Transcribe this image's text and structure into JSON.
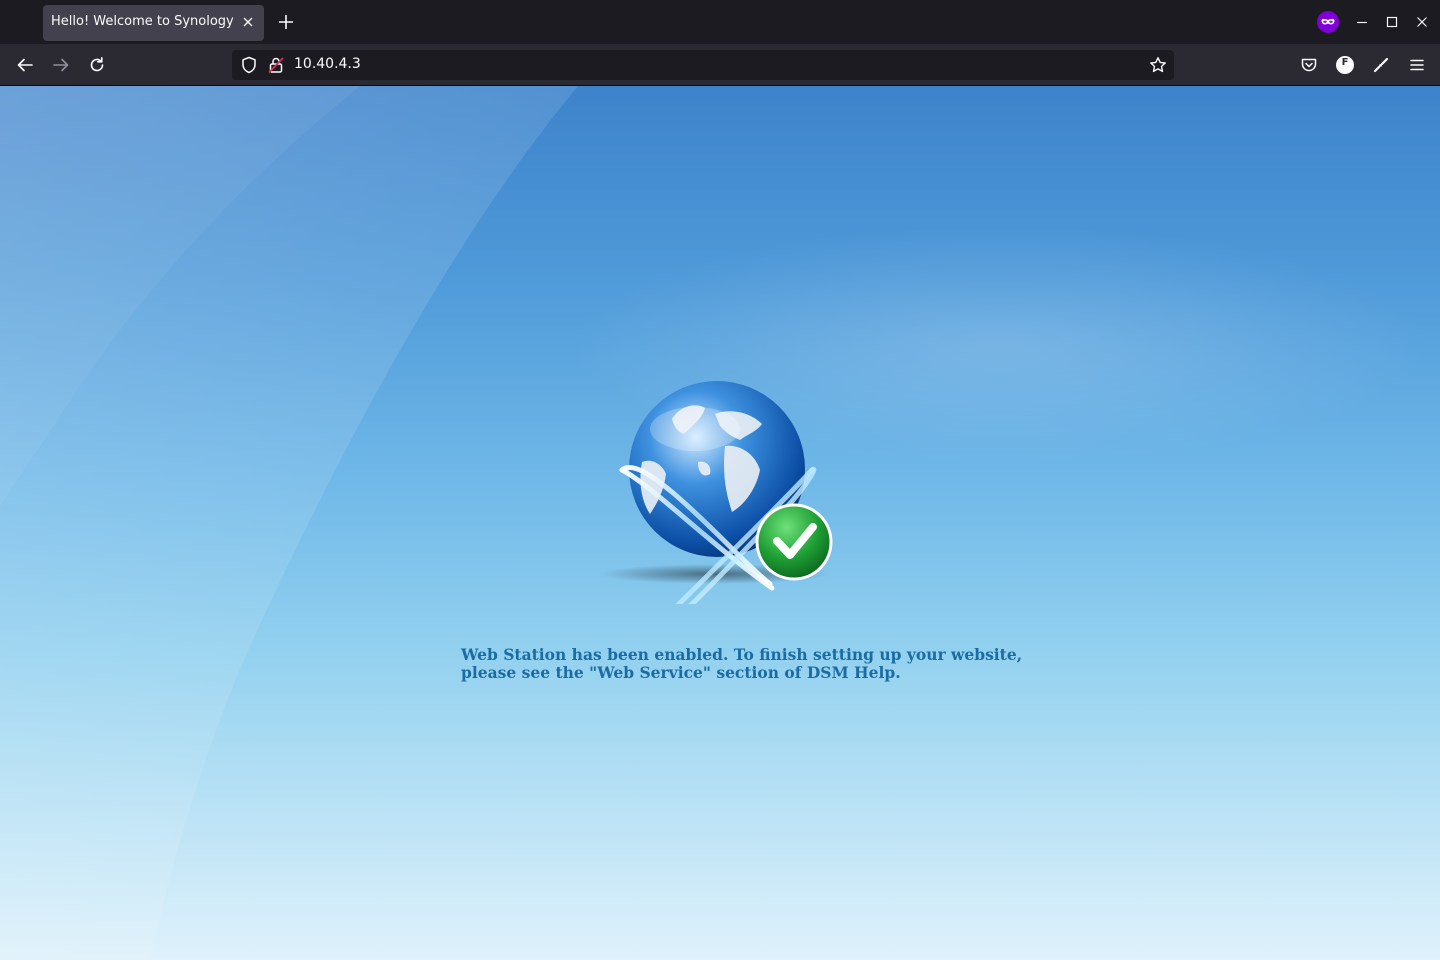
{
  "browser": {
    "tab": {
      "title": "Hello! Welcome to Synology",
      "close_icon": "close-icon"
    },
    "new_tab_icon": "plus-icon",
    "url": "10.40.4.3",
    "icons": {
      "back": "arrow-left-icon",
      "forward": "arrow-right-icon",
      "reload": "reload-icon",
      "tracking_protection": "shield-icon",
      "insecure_connection": "lock-warning-icon",
      "bookmark": "star-icon",
      "pocket": "pocket-icon",
      "account": "firefox-account-icon",
      "extensions": "extensions-icon",
      "menu": "hamburger-menu-icon",
      "private_browsing": "private-mask-icon",
      "minimize": "minimize-icon",
      "maximize": "maximize-icon",
      "close": "window-close-icon"
    },
    "account_initial": "F",
    "colors": {
      "tabbar": "#1c1b22",
      "navbar": "#2b2a33",
      "private_purple": "#8000d7"
    }
  },
  "page": {
    "message_line1": "Web Station has been enabled. To finish setting up your website,",
    "message_line2": "please see the \"Web Service\" section of DSM Help.",
    "hero_icons": [
      "globe-icon",
      "checkmark-badge-icon"
    ],
    "colors": {
      "text": "#1a6ca3",
      "check_green": "#1fa035"
    }
  }
}
